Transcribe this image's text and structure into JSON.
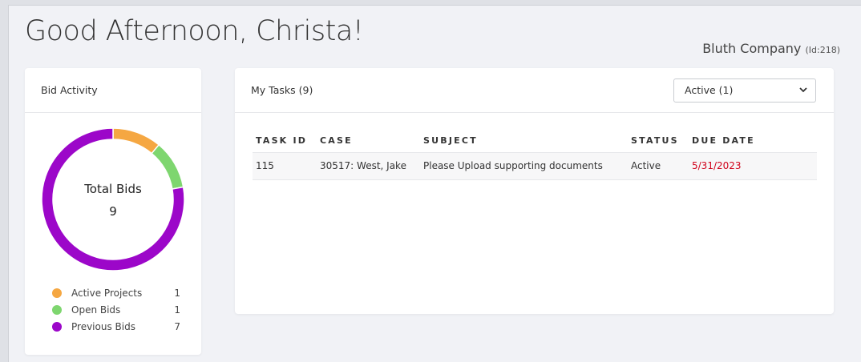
{
  "header": {
    "greeting": "Good Afternoon, Christa!",
    "company_name": "Bluth Company",
    "company_id": "(Id:218)"
  },
  "bid_activity": {
    "title": "Bid Activity",
    "center_title": "Total Bids",
    "center_value": "9",
    "legend": [
      {
        "label": "Active Projects",
        "value": "1",
        "color": "#f5a742"
      },
      {
        "label": "Open Bids",
        "value": "1",
        "color": "#7ed66f"
      },
      {
        "label": "Previous Bids",
        "value": "7",
        "color": "#9c07c9"
      }
    ]
  },
  "chart_data": {
    "type": "pie",
    "categories": [
      "Active Projects",
      "Open Bids",
      "Previous Bids"
    ],
    "values": [
      1,
      1,
      7
    ],
    "colors": [
      "#f5a742",
      "#7ed66f",
      "#9c07c9"
    ],
    "title": "Total Bids"
  },
  "tasks": {
    "title": "My Tasks (9)",
    "filter_selected": "Active (1)",
    "columns": [
      "TASK ID",
      "CASE",
      "SUBJECT",
      "STATUS",
      "DUE DATE"
    ],
    "rows": [
      {
        "task_id": "115",
        "case": "30517: West, Jake",
        "subject": "Please Upload supporting documents",
        "status": "Active",
        "due_date": "5/31/2023"
      }
    ]
  }
}
